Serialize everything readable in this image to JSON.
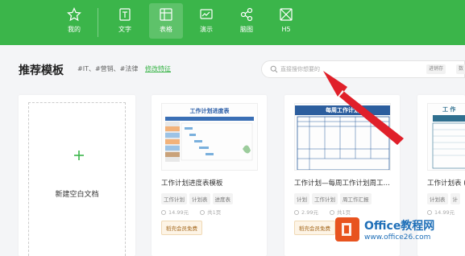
{
  "nav": {
    "items": [
      {
        "label": "我的",
        "icon": "star-icon"
      },
      {
        "label": "文字",
        "icon": "document-icon"
      },
      {
        "label": "表格",
        "icon": "table-icon",
        "active": true
      },
      {
        "label": "演示",
        "icon": "presentation-icon"
      },
      {
        "label": "脑图",
        "icon": "mindmap-icon"
      },
      {
        "label": "H5",
        "icon": "h5-icon"
      }
    ],
    "bg_color": "#3bb54a"
  },
  "header": {
    "title": "推荐模板",
    "tags": "#IT、#营销、#法律",
    "edit_tags": "修改特征"
  },
  "search": {
    "placeholder": "直接搜你想要的",
    "hot_words": [
      "进销存",
      "数"
    ]
  },
  "blank": {
    "label": "新建空白文档"
  },
  "templates": [
    {
      "title": "工作计划进度表模板",
      "thumb_title": "工作计划进度表",
      "tags": [
        "工作计划",
        "计划表",
        "进度表"
      ],
      "price": "14.99元",
      "pages": "共1页",
      "badge": "稻壳会员免费"
    },
    {
      "title": "工作计划—每周工作计划周工…",
      "thumb_title": "每周工作计划",
      "tags": [
        "计划",
        "工作计划",
        "周工作汇报"
      ],
      "price": "2.99元",
      "pages": "共1页",
      "badge": "稻壳会员免费"
    },
    {
      "title": "工作计划表 (",
      "thumb_title": "工 作",
      "tags": [
        "计划表",
        "计"
      ],
      "price": "14.99元",
      "pages": "",
      "badge": ""
    }
  ],
  "watermark": {
    "main": "Office教程网",
    "sub": "www.office26.com"
  },
  "colors": {
    "accent": "#3bb54a",
    "arrow": "#e0202a"
  }
}
